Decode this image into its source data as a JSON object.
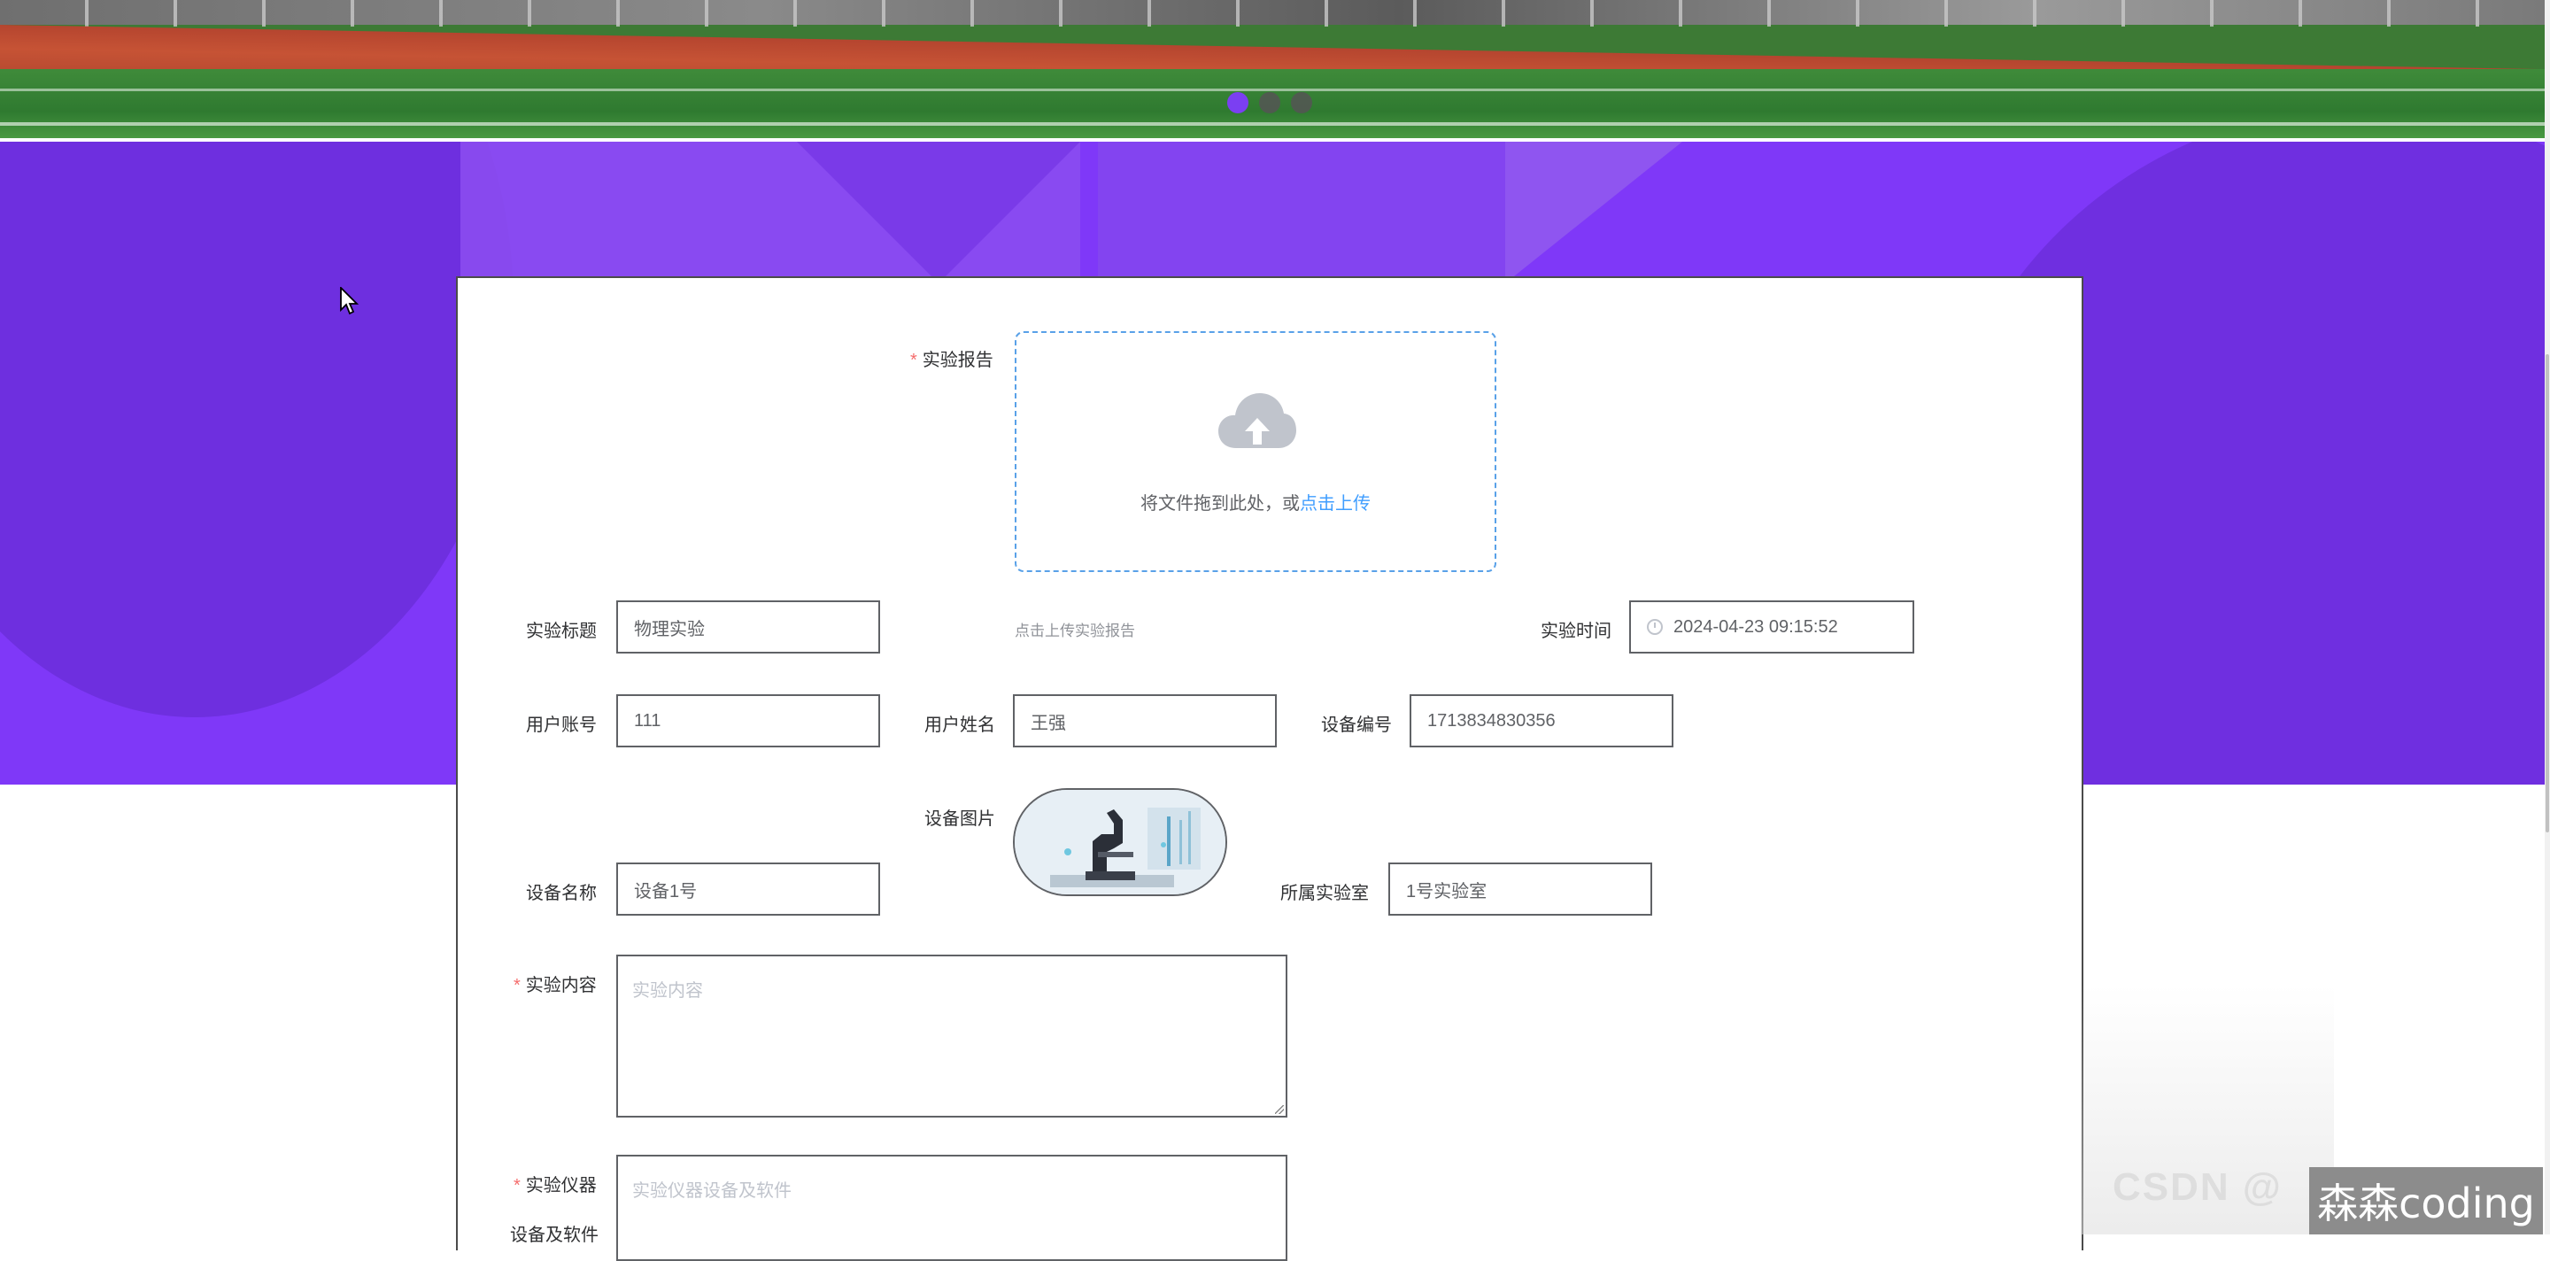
{
  "banner": {
    "dots": [
      true,
      false,
      false
    ]
  },
  "form": {
    "report": {
      "label": "实验报告",
      "upload_text": "将文件拖到此处，或",
      "upload_link": "点击上传",
      "tip": "点击上传实验报告"
    },
    "title": {
      "label": "实验标题",
      "value": "物理实验"
    },
    "time": {
      "label": "实验时间",
      "value": "2024-04-23 09:15:52"
    },
    "account": {
      "label": "用户账号",
      "value": "111"
    },
    "username": {
      "label": "用户姓名",
      "value": "王强"
    },
    "device_no": {
      "label": "设备编号",
      "value": "1713834830356"
    },
    "device_image": {
      "label": "设备图片"
    },
    "device_name": {
      "label": "设备名称",
      "value": "设备1号"
    },
    "lab": {
      "label": "所属实验室",
      "value": "1号实验室"
    },
    "content": {
      "label": "实验内容",
      "placeholder": "实验内容"
    },
    "instrument": {
      "label": "实验仪器",
      "label2": "设备及软件",
      "placeholder": "实验仪器设备及软件"
    }
  },
  "watermark": {
    "text": "森森coding",
    "ghost": "CSDN @"
  },
  "colors": {
    "primary": "#7f38f8",
    "link": "#409eff",
    "required": "#f56c6c"
  }
}
